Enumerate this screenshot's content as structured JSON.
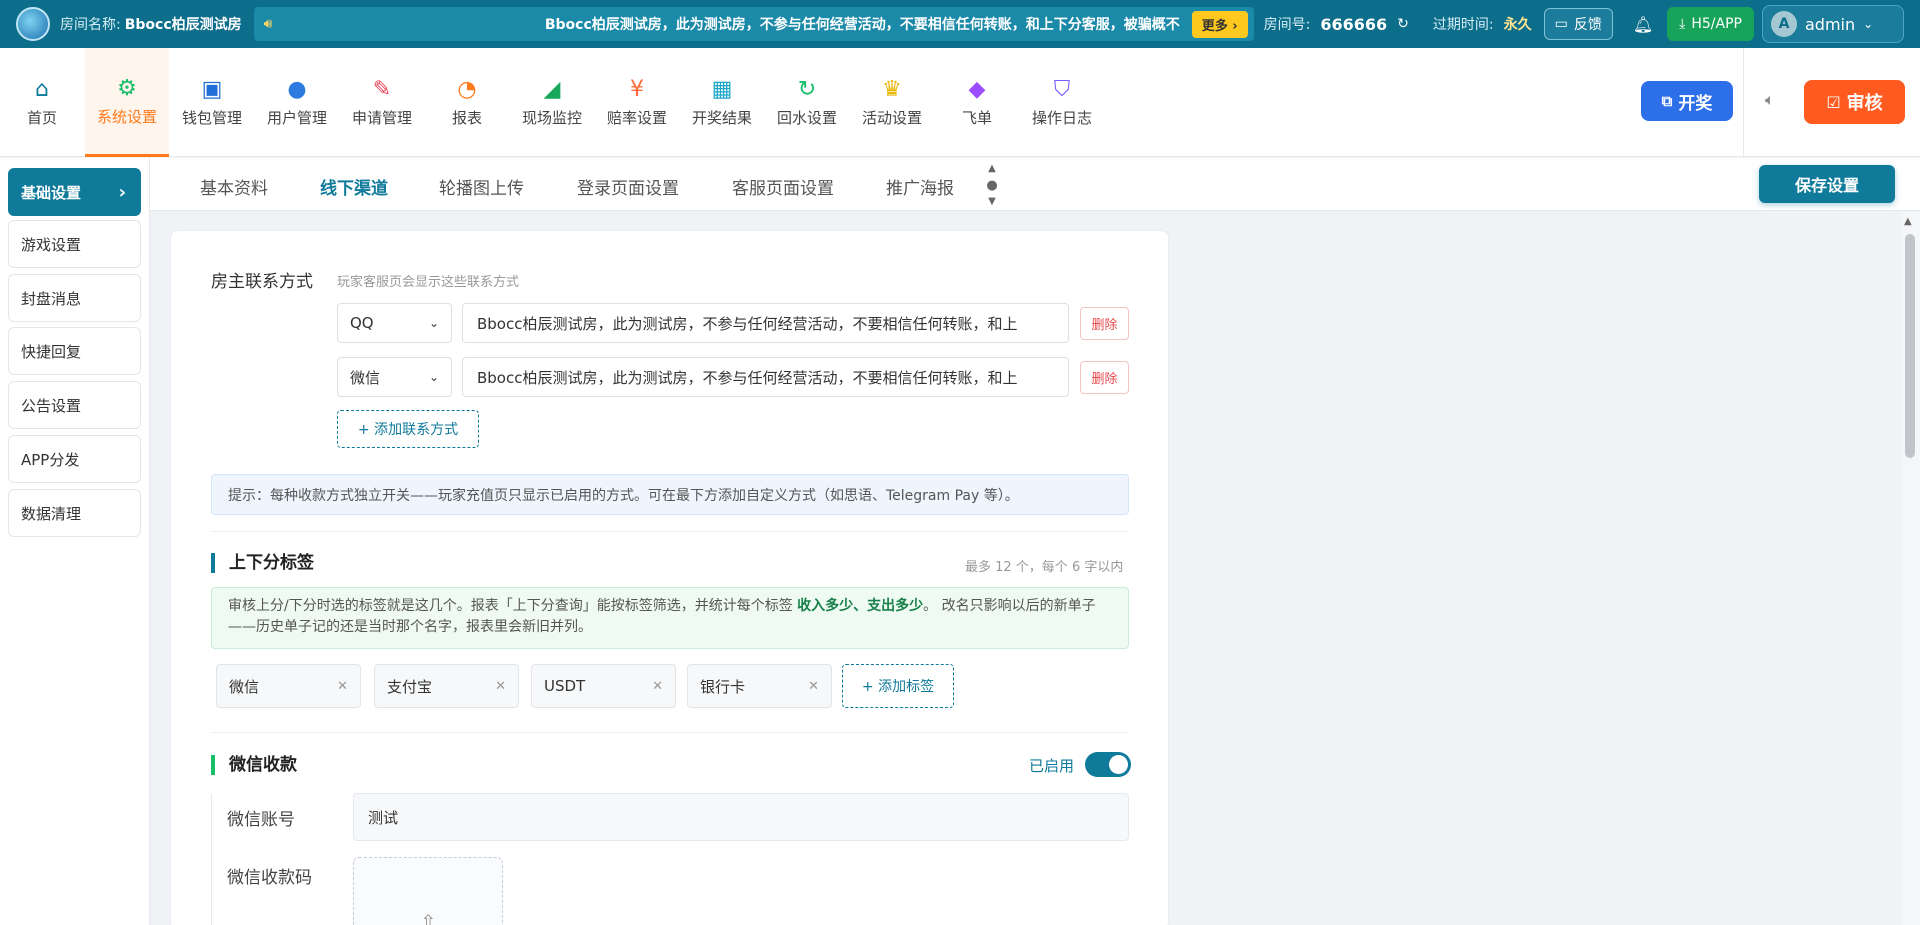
{
  "topbar": {
    "room_label": "房间名称:",
    "room_name": "Bbocc柏辰测试房",
    "marquee_text": "Bbocc柏辰测试房，此为测试房，不参与任何经营活动，不要相信任何转账，和上下分客服，被骗概不",
    "more": "更多 ›",
    "room_no_label": "房间号:",
    "room_no": "666666",
    "expire_label": "过期时间:",
    "expire_value": "永久",
    "feedback": "反馈",
    "h5app": "H5/APP",
    "avatar_letter": "A",
    "user": "admin"
  },
  "nav": {
    "items": [
      {
        "label": "首页",
        "icon": "home-icon",
        "color": "#0f7a9a",
        "glyph": "⌂"
      },
      {
        "label": "系统设置",
        "icon": "gear-icon",
        "color": "#19be6b",
        "glyph": "⚙"
      },
      {
        "label": "钱包管理",
        "icon": "wallet-icon",
        "color": "#1f6fd6",
        "glyph": "▣"
      },
      {
        "label": "用户管理",
        "icon": "user-icon",
        "color": "#2d7be0",
        "glyph": "●"
      },
      {
        "label": "申请管理",
        "icon": "apply-icon",
        "color": "#e8485c",
        "glyph": "✎"
      },
      {
        "label": "报表",
        "icon": "pie-chart-icon",
        "color": "#ff7a1a",
        "glyph": "◔"
      },
      {
        "label": "现场监控",
        "icon": "camera-icon",
        "color": "#19a85a",
        "glyph": "◢"
      },
      {
        "label": "赔率设置",
        "icon": "odds-icon",
        "color": "#ff6b3d",
        "glyph": "¥"
      },
      {
        "label": "开奖结果",
        "icon": "calendar-icon",
        "color": "#1ba6c9",
        "glyph": "▦"
      },
      {
        "label": "回水设置",
        "icon": "refresh-icon",
        "color": "#19be6b",
        "glyph": "↻"
      },
      {
        "label": "活动设置",
        "icon": "trophy-icon",
        "color": "#e8b400",
        "glyph": "♛"
      },
      {
        "label": "飞单",
        "icon": "grid-icon",
        "color": "#9b4dff",
        "glyph": "◆"
      },
      {
        "label": "操作日志",
        "icon": "shield-icon",
        "color": "#7c5cff",
        "glyph": "⛉"
      }
    ],
    "active_index": 1,
    "kaijiang": "开奖",
    "shenhe": "审核"
  },
  "sidebar": {
    "items": [
      "基础设置",
      "游戏设置",
      "封盘消息",
      "快捷回复",
      "公告设置",
      "APP分发",
      "数据清理"
    ],
    "active_index": 0
  },
  "tabs": {
    "items": [
      "基本资料",
      "线下渠道",
      "轮播图上传",
      "登录页面设置",
      "客服页面设置",
      "推广海报"
    ],
    "active_index": 1,
    "save": "保存设置"
  },
  "contact": {
    "label": "房主联系方式",
    "hint": "玩家客服页会显示这些联系方式",
    "rows": [
      {
        "type": "QQ",
        "value": "Bbocc柏辰测试房，此为测试房，不参与任何经营活动，不要相信任何转账，和上"
      },
      {
        "type": "微信",
        "value": "Bbocc柏辰测试房，此为测试房，不参与任何经营活动，不要相信任何转账，和上"
      }
    ],
    "delete": "删除",
    "add": "+ 添加联系方式"
  },
  "notice": "提示：每种收款方式独立开关——玩家充值页只显示已启用的方式。可在最下方添加自定义方式（如思语、Telegram Pay 等）。",
  "tags": {
    "title": "上下分标签",
    "limit": "最多 12 个，每个 6 字以内",
    "info_pre": "审核上分/下分时选的标签就是这几个。报表「上下分查询」能按标签筛选，并统计每个标签 ",
    "info_bold": "收入多少、支出多少",
    "info_post": "。 改名只影响以后的新单子——历史单子记的还是当时那个名字，报表里会新旧并列。",
    "items": [
      "微信",
      "支付宝",
      "USDT",
      "银行卡"
    ],
    "add": "+ 添加标签"
  },
  "wechat": {
    "title": "微信收款",
    "enabled": "已启用",
    "toggle_on": true,
    "account_label": "微信账号",
    "account_value": "测试",
    "qrcode_label": "微信收款码"
  },
  "colors": {
    "primary": "#0f7a9a",
    "orange": "#ff7a1a",
    "danger": "#e8484c",
    "green": "#19be6b"
  }
}
